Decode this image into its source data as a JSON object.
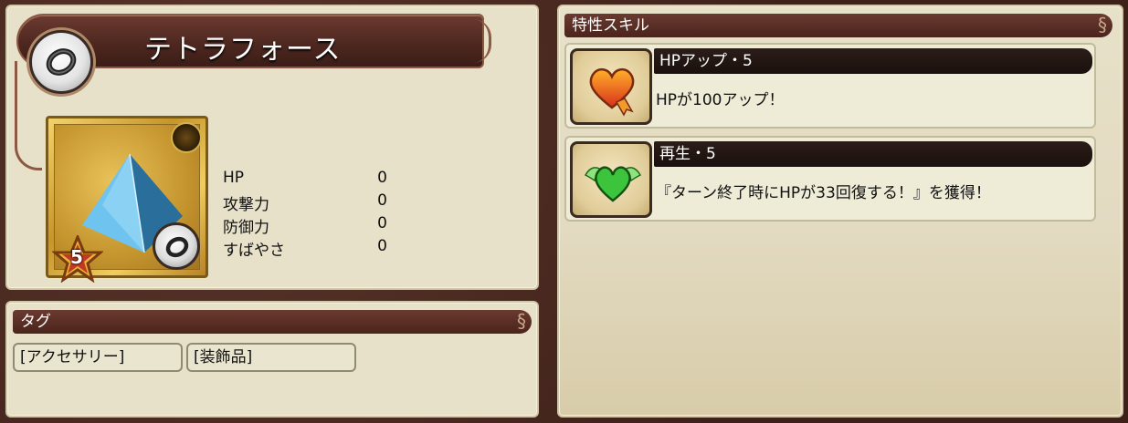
{
  "item": {
    "name": "テトラフォース",
    "rank": "5",
    "icon": "pyramid-icon",
    "category_icon": "ring-icon"
  },
  "stats": [
    {
      "label": "HP",
      "value": "0"
    },
    {
      "label": "攻撃力",
      "value": "0"
    },
    {
      "label": "防御力",
      "value": "0"
    },
    {
      "label": "すばやさ",
      "value": "0"
    }
  ],
  "tags": {
    "header": "タグ",
    "items": [
      "[アクセサリー]",
      "[装飾品]"
    ]
  },
  "skills": {
    "header": "特性スキル",
    "items": [
      {
        "name": "HPアップ・5",
        "description": "HPが100アップ！",
        "icon": "heart-ribbon-icon",
        "color": "#e8551c"
      },
      {
        "name": "再生・5",
        "description": "『ターン終了時にHPが33回復する！』を獲得！",
        "icon": "winged-heart-icon",
        "color": "#2bb32b"
      }
    ]
  },
  "colors": {
    "frame": "#4a2a22",
    "panel": "#e6e1c8",
    "header": "#4a241c",
    "card_gold": "#c6952b"
  }
}
